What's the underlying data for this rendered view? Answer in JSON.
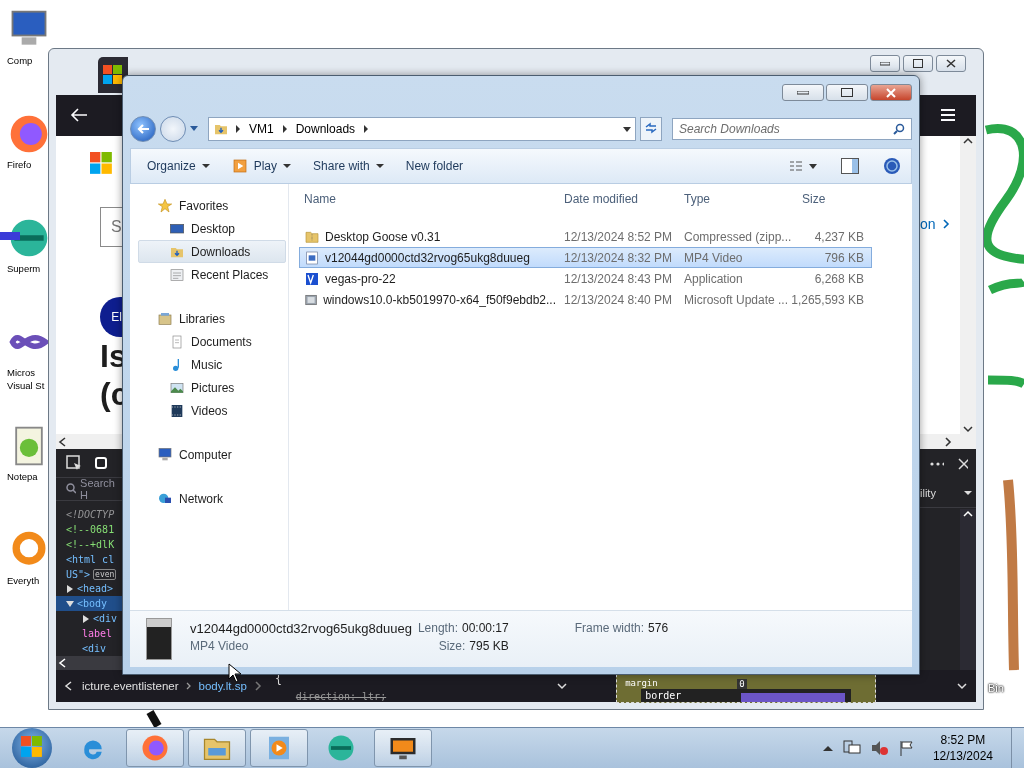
{
  "desktop": {
    "icons": [
      {
        "label": "Comp",
        "kind": "computer"
      },
      {
        "label": "Firefo",
        "kind": "firefox"
      },
      {
        "label": "Superm",
        "kind": "globe"
      },
      {
        "label": "Micros Visual St",
        "kind": "studio"
      },
      {
        "label": "Notepa",
        "kind": "notepad"
      },
      {
        "label": "Everyth",
        "kind": "search"
      }
    ],
    "right_icon": {
      "label": "Bin"
    }
  },
  "browser": {
    "page": {
      "search_placeholder": "S",
      "link": "on",
      "avatar": "El",
      "heading_lines": [
        "Is",
        "(c"
      ]
    },
    "devtools": {
      "search_placeholder": "Search H",
      "panel_tab": "ility",
      "code_lines": [
        {
          "text": "<!DOCTYP",
          "kind": "doctype",
          "selected": false
        },
        {
          "text": "<!--0681",
          "kind": "comment",
          "selected": false
        },
        {
          "text": "<!--+dlK",
          "kind": "comment",
          "selected": false
        },
        {
          "text": "<html cl",
          "kind": "tag",
          "selected": false
        },
        {
          "text": "US\">",
          "kind": "tag",
          "badge": "even",
          "selected": false
        },
        {
          "text": "<head>",
          "kind": "node",
          "expanded": false,
          "selected": false
        },
        {
          "text": "<body",
          "kind": "node",
          "expanded": true,
          "selected": true
        },
        {
          "text": "<div",
          "kind": "child",
          "expanded": false,
          "selected": false
        },
        {
          "text": "label",
          "kind": "attr",
          "selected": false
        },
        {
          "text": "<div",
          "kind": "child-plain",
          "selected": false
        }
      ],
      "breadcrumbs": [
        {
          "label": "icture.eventlistener",
          "selected": false
        },
        {
          "label": "body.lt.sp",
          "selected": true
        }
      ],
      "rule_brace": "{",
      "declaration": "direction: ltr;",
      "box_model": {
        "margin": "margin",
        "border": "border",
        "value": "0"
      }
    }
  },
  "explorer": {
    "path": [
      "VM1",
      "Downloads"
    ],
    "search_placeholder": "Search Downloads",
    "commands": [
      {
        "label": "Organize",
        "kind": "plain",
        "has_menu": true
      },
      {
        "label": "Play",
        "kind": "play",
        "has_menu": true
      },
      {
        "label": "Share with",
        "kind": "plain",
        "has_menu": true
      },
      {
        "label": "New folder",
        "kind": "plain",
        "has_menu": false
      }
    ],
    "nav": [
      {
        "label": "Favorites",
        "kind": "star",
        "children": [
          {
            "label": "Desktop",
            "kind": "desktop",
            "selected": false
          },
          {
            "label": "Downloads",
            "kind": "downloads",
            "selected": true
          },
          {
            "label": "Recent Places",
            "kind": "recent",
            "selected": false
          }
        ]
      },
      {
        "label": "Libraries",
        "kind": "libraries",
        "children": [
          {
            "label": "Documents",
            "kind": "documents",
            "selected": false
          },
          {
            "label": "Music",
            "kind": "music",
            "selected": false
          },
          {
            "label": "Pictures",
            "kind": "pictures",
            "selected": false
          },
          {
            "label": "Videos",
            "kind": "videos",
            "selected": false
          }
        ]
      },
      {
        "label": "Computer",
        "kind": "computer"
      },
      {
        "label": "Network",
        "kind": "network"
      }
    ],
    "columns": [
      "Name",
      "Date modified",
      "Type",
      "Size"
    ],
    "files": [
      {
        "name": "Desktop Goose v0.31",
        "date": "12/13/2024 8:52 PM",
        "type": "Compressed (zipp...",
        "size": "4,237 KB",
        "kind": "zip",
        "selected": false
      },
      {
        "name": "v12044gd0000ctd32rvog65ukg8duueg",
        "date": "12/13/2024 8:32 PM",
        "type": "MP4 Video",
        "size": "796 KB",
        "kind": "video",
        "selected": true
      },
      {
        "name": "vegas-pro-22",
        "date": "12/13/2024 8:43 PM",
        "type": "Application",
        "size": "6,268 KB",
        "kind": "app",
        "selected": false
      },
      {
        "name": "windows10.0-kb5019970-x64_f50f9ebdb2...",
        "date": "12/13/2024 8:40 PM",
        "type": "Microsoft Update ...",
        "size": "1,265,593 KB",
        "kind": "update",
        "selected": false
      }
    ],
    "details": {
      "name": "v12044gd0000ctd32rvog65ukg8duueg",
      "type": "MP4 Video",
      "fields": [
        {
          "label": "Length:",
          "value": "00:00:17"
        },
        {
          "label": "Size:",
          "value": "795 KB"
        },
        {
          "label": "Frame width:",
          "value": "576"
        }
      ]
    }
  },
  "taskbar": {
    "apps": [
      {
        "kind": "ie",
        "running": false
      },
      {
        "kind": "firefox",
        "running": true
      },
      {
        "kind": "folder",
        "running": true
      },
      {
        "kind": "media",
        "running": true
      },
      {
        "kind": "globe",
        "running": false
      },
      {
        "kind": "monitor",
        "running": true
      }
    ],
    "time": "8:52 PM",
    "date": "12/13/2024"
  }
}
